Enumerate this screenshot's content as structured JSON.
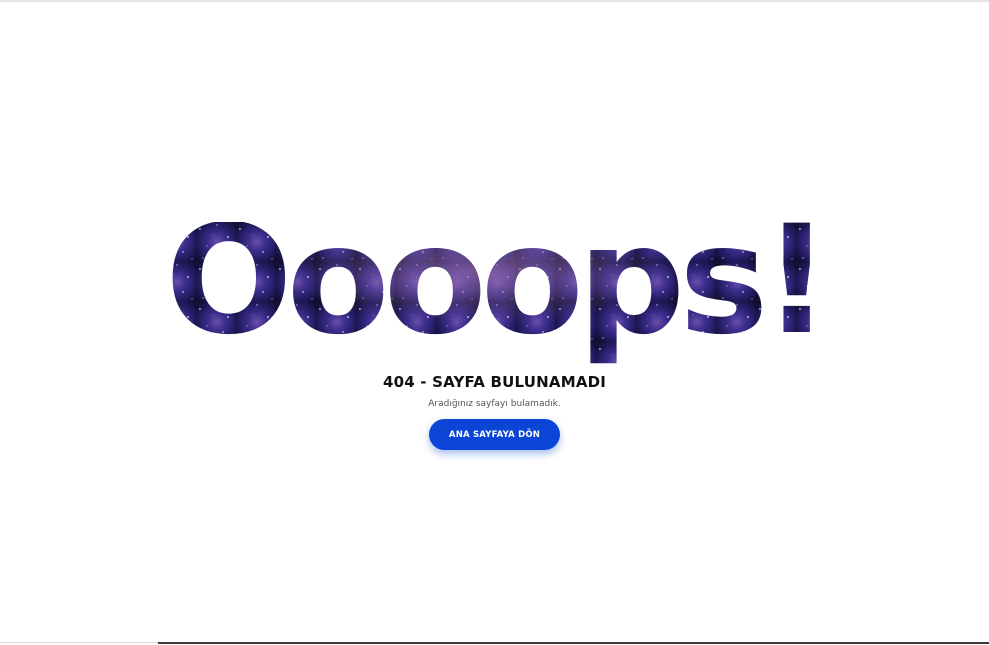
{
  "headline": "Oooops!",
  "error": {
    "title": "404 - SAYFA BULUNAMADI",
    "message": "Aradığınız sayfayı bulamadık."
  },
  "actions": {
    "home_label": "ANA SAYFAYA DÖN"
  },
  "colors": {
    "accent": "#0a45d6",
    "galaxy_dark": "#1a1446",
    "galaxy_mid": "#3b2d8c",
    "galaxy_light": "#6a4fa8"
  }
}
